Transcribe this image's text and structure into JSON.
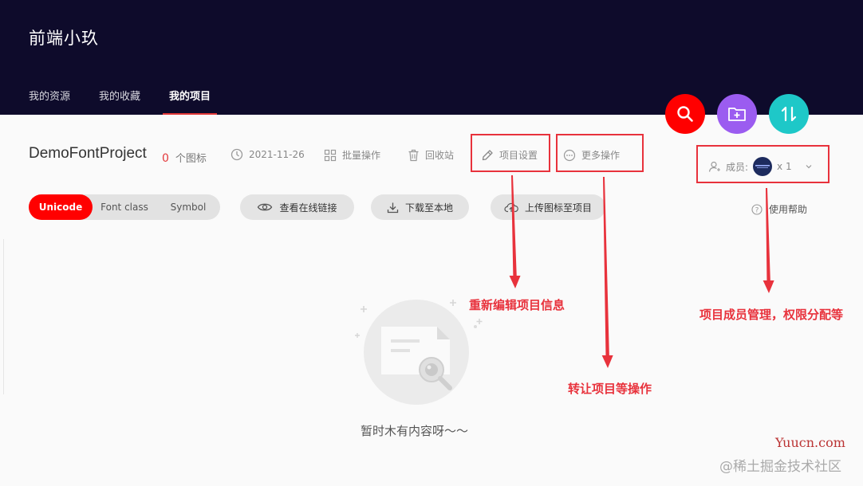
{
  "site": {
    "title": "前端小玖"
  },
  "nav": {
    "tabs": [
      {
        "label": "我的资源"
      },
      {
        "label": "我的收藏"
      },
      {
        "label": "我的项目",
        "active": true
      }
    ]
  },
  "actions": {
    "search_icon": "search-icon",
    "add_folder_icon": "folder-add-icon",
    "sort_icon": "sort-icon"
  },
  "project": {
    "name": "DemoFontProject",
    "icon_count": "0",
    "icon_count_label": "个图标",
    "date": "2021-11-26",
    "batch_label": "批量操作",
    "trash_label": "回收站",
    "settings_label": "项目设置",
    "more_label": "更多操作"
  },
  "members": {
    "label": "成员:",
    "count": "x 1"
  },
  "help": {
    "label": "使用帮助"
  },
  "format_tabs": [
    {
      "label": "Unicode",
      "active": true
    },
    {
      "label": "Font class"
    },
    {
      "label": "Symbol"
    }
  ],
  "buttons": {
    "view_link": "查看在线链接",
    "download": "下载至本地",
    "upload": "上传图标至项目"
  },
  "annotations": {
    "settings": "重新编辑项目信息",
    "more": "转让项目等操作",
    "members": "项目成员管理，权限分配等"
  },
  "empty": {
    "text": "暂时木有内容呀～～"
  },
  "watermark": {
    "line1": "Yuucn.com",
    "line2": "@稀土掘金技术社区"
  },
  "colors": {
    "header_bg": "#0e0b2b",
    "accent": "#ff0000",
    "search_fab": "#ff0000",
    "folder_fab": "#9b5cf0",
    "sort_fab": "#1ec8c8",
    "annotation": "#e8323c"
  }
}
